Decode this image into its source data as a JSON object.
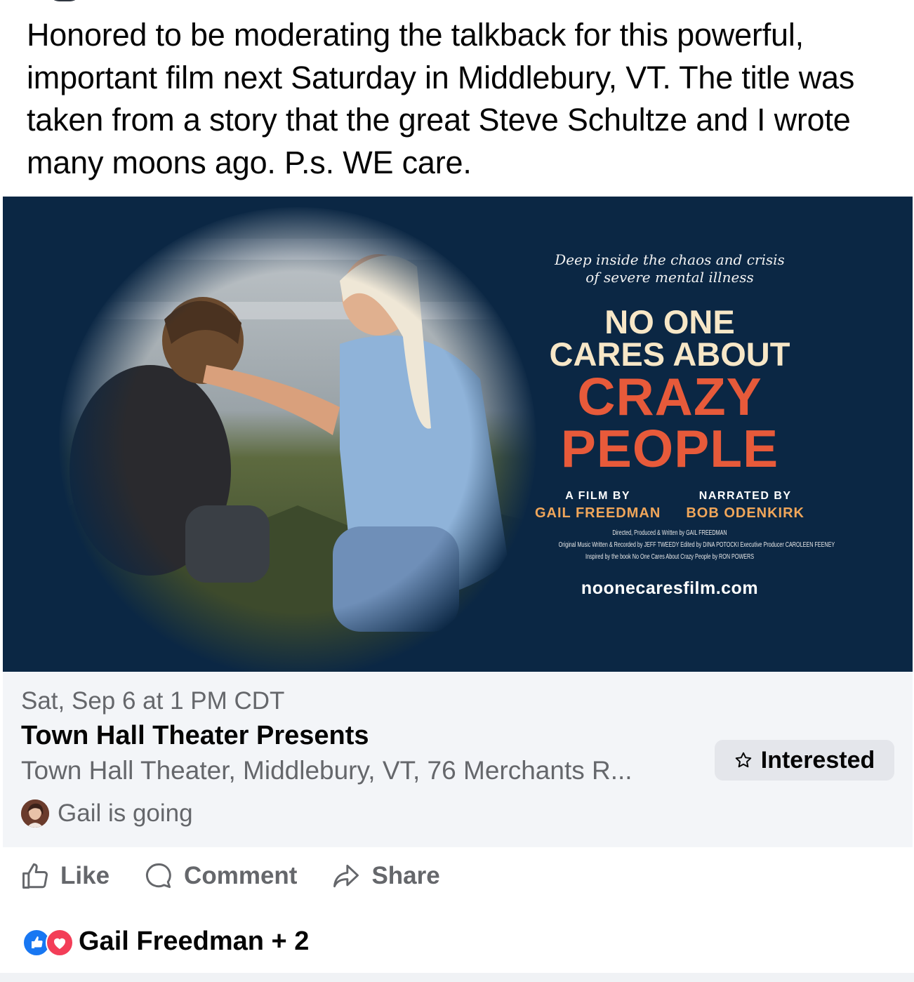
{
  "post": {
    "text": "Honored to be moderating the talkback for this powerful, important film next Saturday in Middlebury, VT. The title was taken from a story that the great Steve Schultze and I wrote many moons ago. P.s. WE care."
  },
  "poster": {
    "tagline_1": "Deep inside the chaos and crisis",
    "tagline_2": "of severe mental illness",
    "title_line_1": "NO ONE",
    "title_line_2": "CARES ABOUT",
    "title_line_3": "CRAZY",
    "title_line_4": "PEOPLE",
    "film_by_label": "A FILM BY",
    "film_by_name": "GAIL FREEDMAN",
    "narrated_label": "NARRATED BY",
    "narrated_name": "BOB ODENKIRK",
    "fine_1": "Directed, Produced & Written by GAIL FREEDMAN",
    "fine_2": "Original Music Written & Recorded by JEFF TWEEDY   Edited by DINA POTOCKI   Executive Producer CAROLEEN FEENEY",
    "fine_3": "Inspired by the book No One Cares About Crazy People by RON POWERS",
    "website": "noonecaresfilm.com",
    "colors": {
      "background": "#0b2744",
      "accent": "#e75a3a",
      "cream": "#f7e7c7",
      "orange": "#f0a65a"
    }
  },
  "event": {
    "date": "Sat, Sep 6 at 1 PM CDT",
    "title": "Town Hall Theater Presents",
    "location": "Town Hall Theater, Middlebury, VT, 76 Merchants R...",
    "going": "Gail is going",
    "interested_label": "Interested",
    "interested_icon": "star-outline-icon"
  },
  "actions": {
    "like": "Like",
    "comment": "Comment",
    "share": "Share"
  },
  "reactions": {
    "text": "Gail Freedman + 2",
    "icons": [
      "like-reaction-icon",
      "love-reaction-icon"
    ]
  }
}
